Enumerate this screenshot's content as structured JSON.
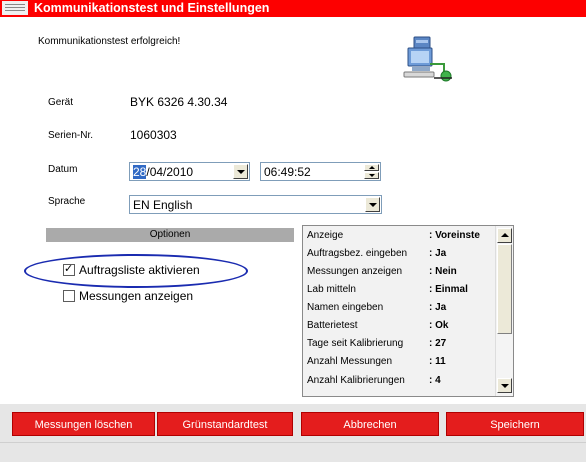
{
  "window": {
    "title": "Kommunikationstest und Einstellungen",
    "accent_color": "#fd0000"
  },
  "status": {
    "message": "Kommunikationstest erfolgreich!",
    "icon": "network-computer-icon"
  },
  "device": {
    "label": "Gerät",
    "value": "BYK 6326 4.30.34"
  },
  "serial": {
    "label": "Serien-Nr.",
    "value": "1060303"
  },
  "date": {
    "label": "Datum",
    "day_selected": "28",
    "rest": "/04/2010",
    "time": "06:49:52"
  },
  "language": {
    "label": "Sprache",
    "value": "EN English"
  },
  "options": {
    "header": "Optionen",
    "checkboxes": [
      {
        "label": "Auftragsliste aktivieren",
        "checked": true
      },
      {
        "label": "Messungen anzeigen",
        "checked": false
      }
    ]
  },
  "settings_list": [
    {
      "key": "Anzeige",
      "value": ": Voreinste"
    },
    {
      "key": "Auftragsbez. eingeben",
      "value": ": Ja"
    },
    {
      "key": "Messungen anzeigen",
      "value": ": Nein"
    },
    {
      "key": "Lab mitteln",
      "value": ": Einmal"
    },
    {
      "key": "Namen eingeben",
      "value": ": Ja"
    },
    {
      "key": "Batterietest",
      "value": ": Ok"
    },
    {
      "key": "Tage seit Kalibrierung",
      "value": ": 27"
    },
    {
      "key": "Anzahl Messungen",
      "value": ": 11"
    },
    {
      "key": "Anzahl Kalibrierungen",
      "value": ": 4"
    }
  ],
  "buttons": {
    "delete": "Messungen löschen",
    "green_test": "Grünstandardtest",
    "cancel": "Abbrechen",
    "save": "Speichern",
    "color": "#e41d1d"
  }
}
